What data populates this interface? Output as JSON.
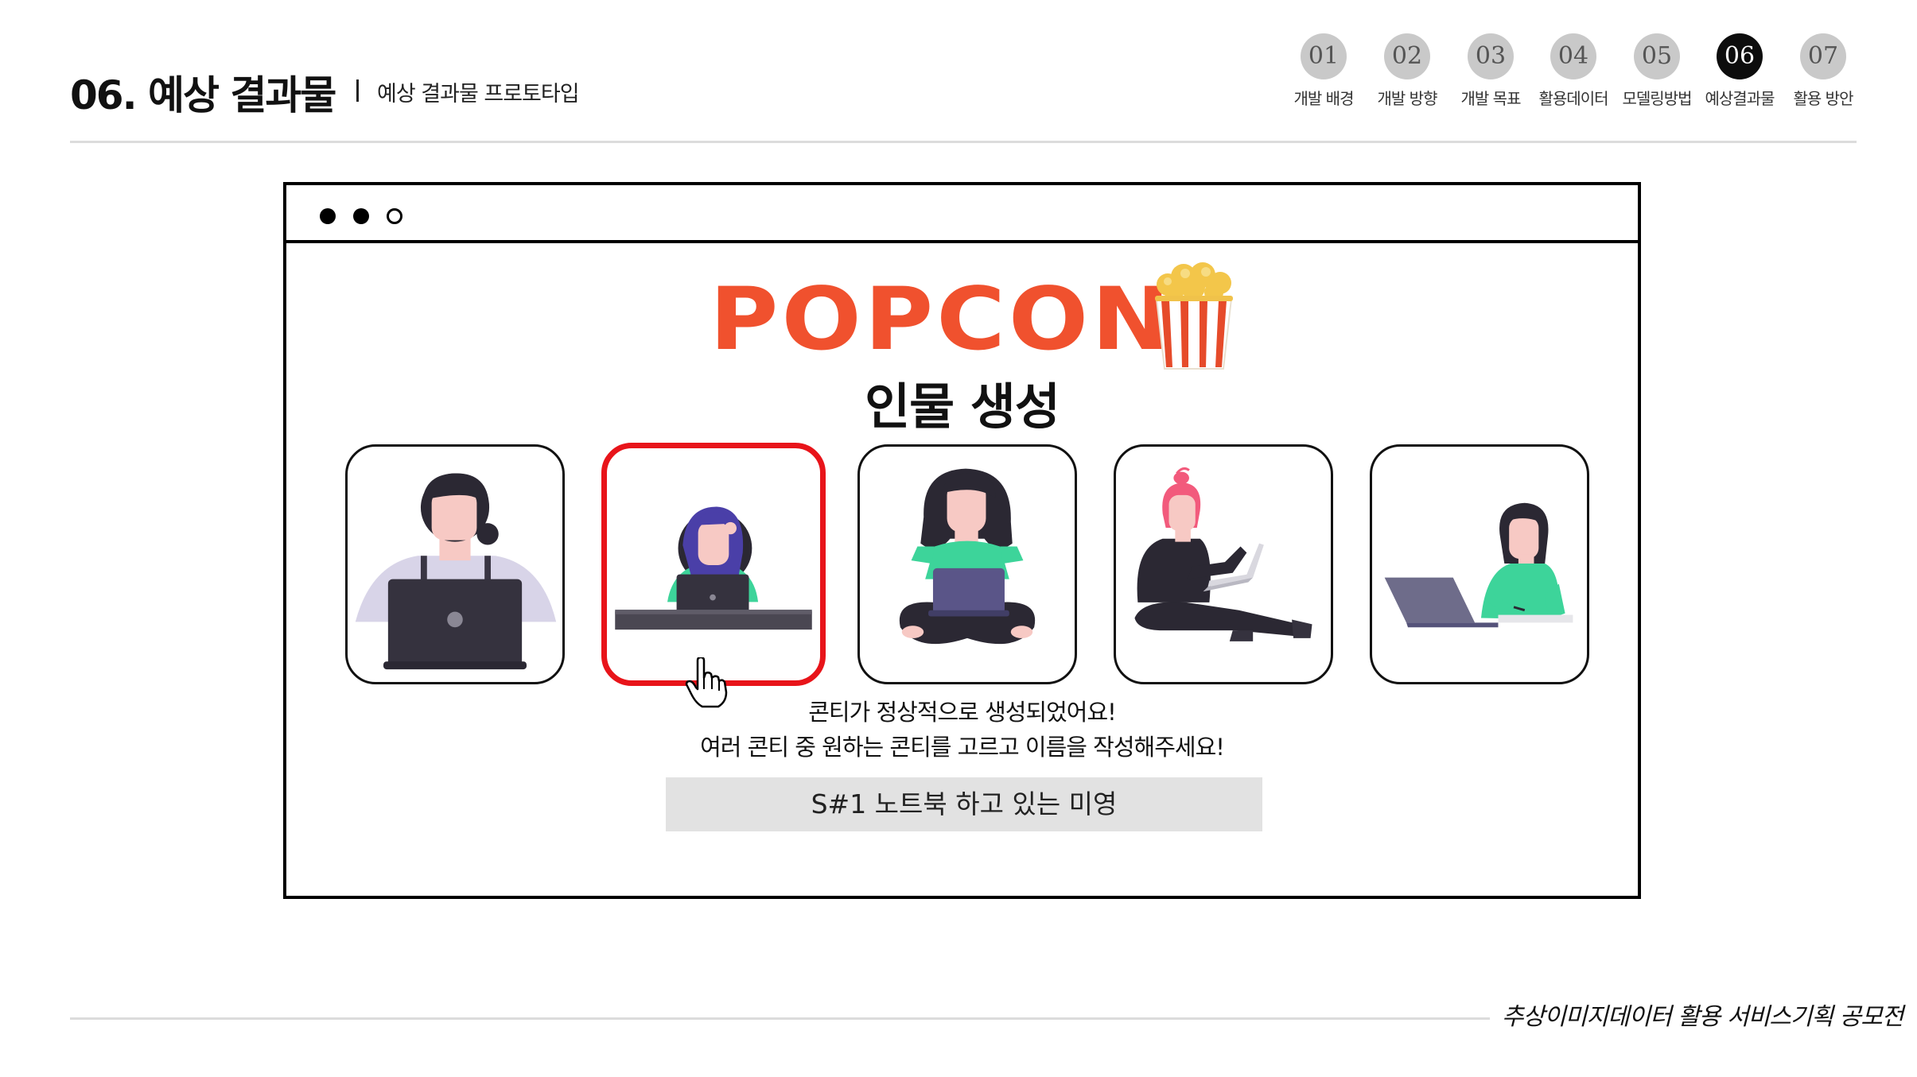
{
  "slide": {
    "title": "06. 예상 결과물",
    "subtitle": "예상 결과물 프로토타입"
  },
  "steps": [
    {
      "num": "01",
      "label": "개발 배경",
      "active": false
    },
    {
      "num": "02",
      "label": "개발 방향",
      "active": false
    },
    {
      "num": "03",
      "label": "개발 목표",
      "active": false
    },
    {
      "num": "04",
      "label": "활용데이터",
      "active": false
    },
    {
      "num": "05",
      "label": "모델링방법",
      "active": false
    },
    {
      "num": "06",
      "label": "예상결과물",
      "active": true
    },
    {
      "num": "07",
      "label": "활용 방안",
      "active": false
    }
  ],
  "app": {
    "logo": "POPCON",
    "screen_title": "인물 생성",
    "cards": [
      {
        "icon": "woman-laptop-front-illustration",
        "selected": false
      },
      {
        "icon": "woman-laptop-desk-illustration",
        "selected": true
      },
      {
        "icon": "woman-laptop-crosslegged-illustration",
        "selected": false
      },
      {
        "icon": "woman-laptop-floor-illustration",
        "selected": false
      },
      {
        "icon": "woman-writing-laptop-illustration",
        "selected": false
      }
    ],
    "message_line1": "콘티가 정상적으로 생성되었어요!",
    "message_line2": "여러 콘티 중 원하는  콘티를 고르고 이름을 작성해주세요!",
    "name_value": "S#1 노트북 하고 있는 미영"
  },
  "footer": {
    "text": "추상이미지데이터 활용 서비스기획 공모전"
  },
  "colors": {
    "brand": "#f0512e",
    "selected_border": "#e8141a",
    "accent_green": "#3dd49a",
    "step_inactive": "#c9c9c9",
    "step_active": "#0d0d0d"
  }
}
